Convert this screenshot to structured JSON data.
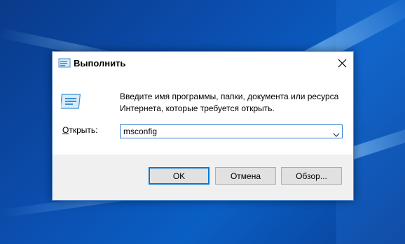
{
  "dialog": {
    "title": "Выполнить",
    "close_icon": "close-icon",
    "app_icon": "run-icon",
    "description": "Введите имя программы, папки, документа или ресурса Интернета, которые требуется открыть.",
    "open_label_accel": "О",
    "open_label_rest": "ткрыть:",
    "input_value": "msconfig",
    "buttons": {
      "ok": "OK",
      "cancel": "Отмена",
      "browse": "Обзор..."
    },
    "colors": {
      "accent": "#0078d7",
      "desktop": "#0b4fb0",
      "footer": "#f0f0f0"
    }
  }
}
